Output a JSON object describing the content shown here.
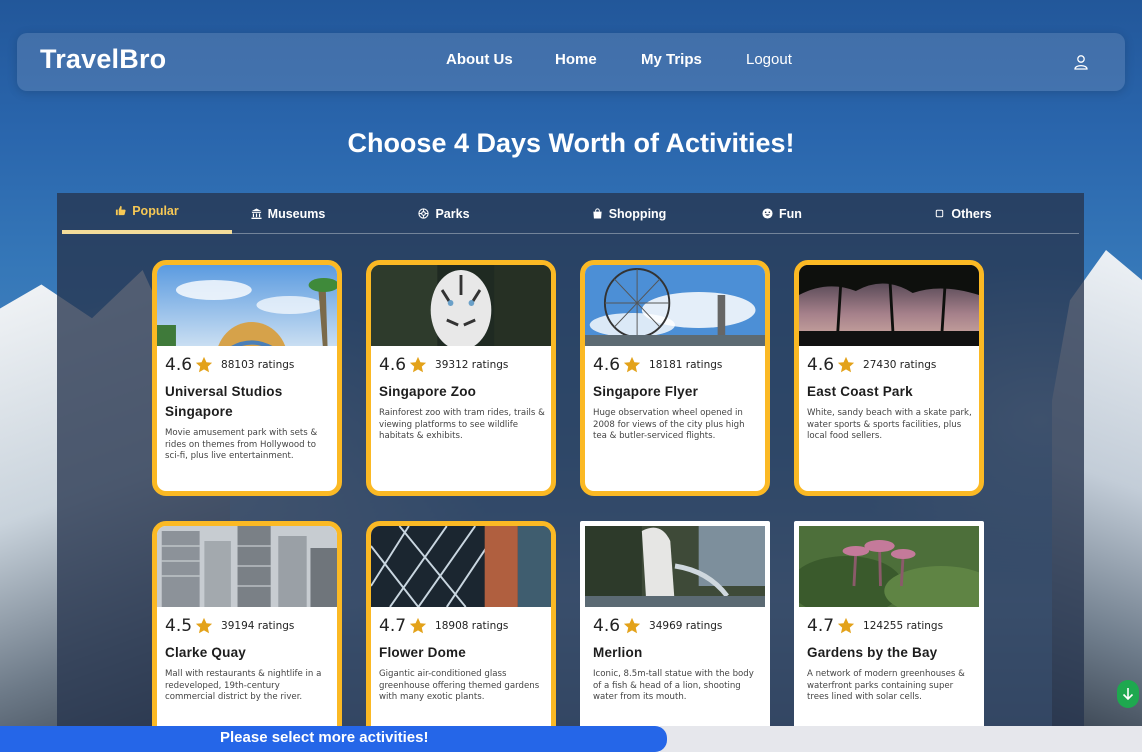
{
  "brand": "TravelBro",
  "nav": {
    "links": [
      "About Us",
      "Home",
      "My Trips",
      "Logout"
    ],
    "user_icon": "user-icon"
  },
  "heading": "Choose 4 Days Worth of Activities!",
  "tabs": [
    {
      "label": "Popular",
      "icon": "thumbs-up-icon",
      "active": true
    },
    {
      "label": "Museums",
      "icon": "museum-icon",
      "active": false
    },
    {
      "label": "Parks",
      "icon": "park-icon",
      "active": false
    },
    {
      "label": "Shopping",
      "icon": "shopping-bag-icon",
      "active": false
    },
    {
      "label": "Fun",
      "icon": "smiley-icon",
      "active": false
    },
    {
      "label": "Others",
      "icon": "square-icon",
      "active": false
    }
  ],
  "cards": [
    {
      "rating": "4.6",
      "count": "88103 ratings",
      "title": "Universal Studios Singapore",
      "desc": "Movie amusement park with sets & rides on themes from Hollywood to sci-fi, plus live entertainment.",
      "selected": true
    },
    {
      "rating": "4.6",
      "count": "39312 ratings",
      "title": "Singapore Zoo",
      "desc": "Rainforest zoo with tram rides, trails & viewing platforms to see wildlife habitats & exhibits.",
      "selected": true
    },
    {
      "rating": "4.6",
      "count": "18181 ratings",
      "title": "Singapore Flyer",
      "desc": "Huge observation wheel opened in 2008 for views of the city plus high tea & butler-serviced flights.",
      "selected": true
    },
    {
      "rating": "4.6",
      "count": "27430 ratings",
      "title": "East Coast Park",
      "desc": "White, sandy beach with a skate park, water sports & sports facilities, plus local food sellers.",
      "selected": true
    },
    {
      "rating": "4.5",
      "count": "39194 ratings",
      "title": "Clarke Quay",
      "desc": "Mall with restaurants & nightlife in a redeveloped, 19th-century commercial district by the river.",
      "selected": true
    },
    {
      "rating": "4.7",
      "count": "18908 ratings",
      "title": "Flower Dome",
      "desc": "Gigantic air-conditioned glass greenhouse offering themed gardens with many exotic plants.",
      "selected": true
    },
    {
      "rating": "4.6",
      "count": "34969 ratings",
      "title": "Merlion",
      "desc": "Iconic, 8.5m-tall statue with the body of a fish & head of a lion, shooting water from its mouth.",
      "selected": false
    },
    {
      "rating": "4.7",
      "count": "124255 ratings",
      "title": "Gardens by the Bay",
      "desc": "A network of modern greenhouses & waterfront parks containing super trees lined with solar cells.",
      "selected": false
    }
  ],
  "banner": {
    "text": "Please select more activities!"
  },
  "colors": {
    "accent": "#fbb924",
    "banner": "#2566e8",
    "scroll_button": "#1ea84f"
  }
}
